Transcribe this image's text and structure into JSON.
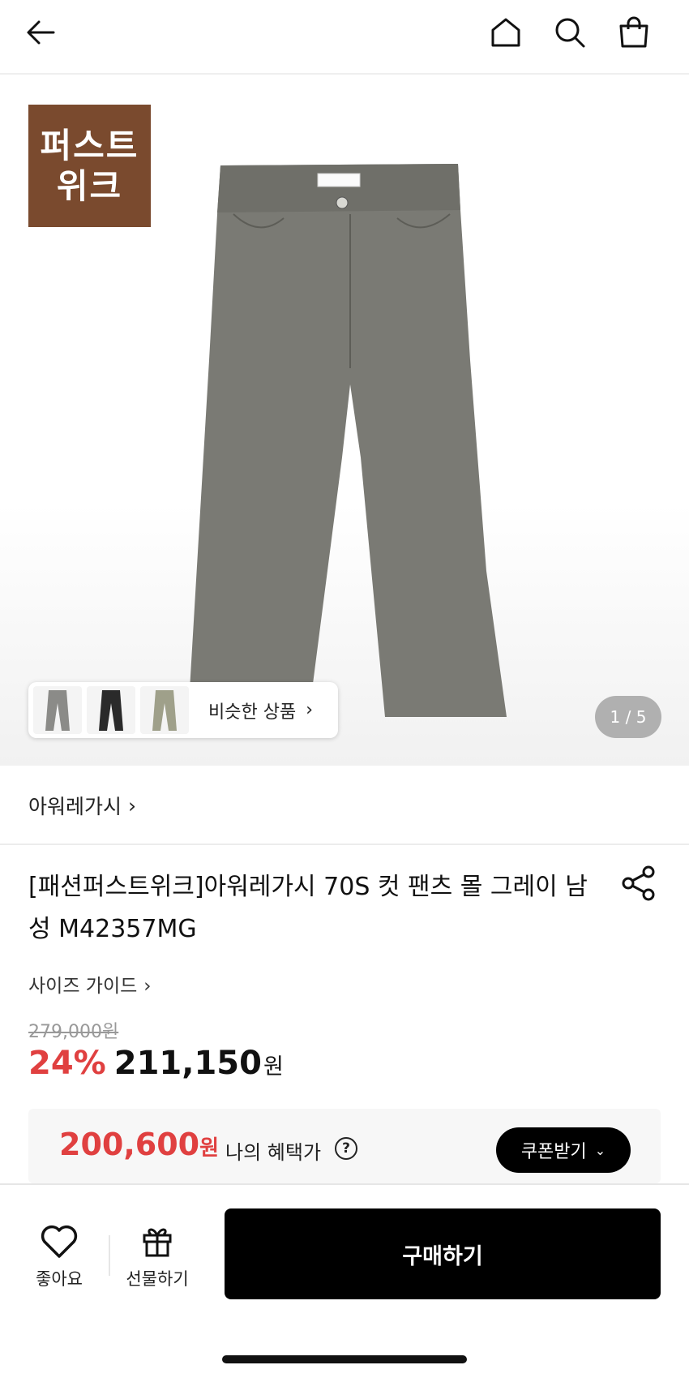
{
  "header": {
    "back_icon": "arrow-left-icon",
    "home_icon": "home-icon",
    "search_icon": "search-icon",
    "cart_icon": "shopping-bag-icon"
  },
  "hero": {
    "badge_line1": "퍼스트",
    "badge_line2": "위크",
    "badge_color": "#7a4a2e",
    "similar_label": "비슷한 상품",
    "similar_chevron": "›",
    "counter": "1 / 5"
  },
  "brand": {
    "name": "아워레가시",
    "chevron": "›"
  },
  "product": {
    "title": "[패션퍼스트위크]아워레가시 70S 컷 팬츠 몰 그레이 남성 M42357MG",
    "size_guide": "사이즈 가이드",
    "size_chevron": "›",
    "original_price": "279,000원",
    "discount": "24%",
    "price": "211,150",
    "price_unit": "원"
  },
  "benefit": {
    "price": "200,600",
    "unit": "원",
    "label": "나의 혜택가",
    "help": "?",
    "coupon_label": "쿠폰받기",
    "accent": "#e04040"
  },
  "bottom": {
    "like_label": "좋아요",
    "gift_label": "선물하기",
    "buy_label": "구매하기"
  }
}
